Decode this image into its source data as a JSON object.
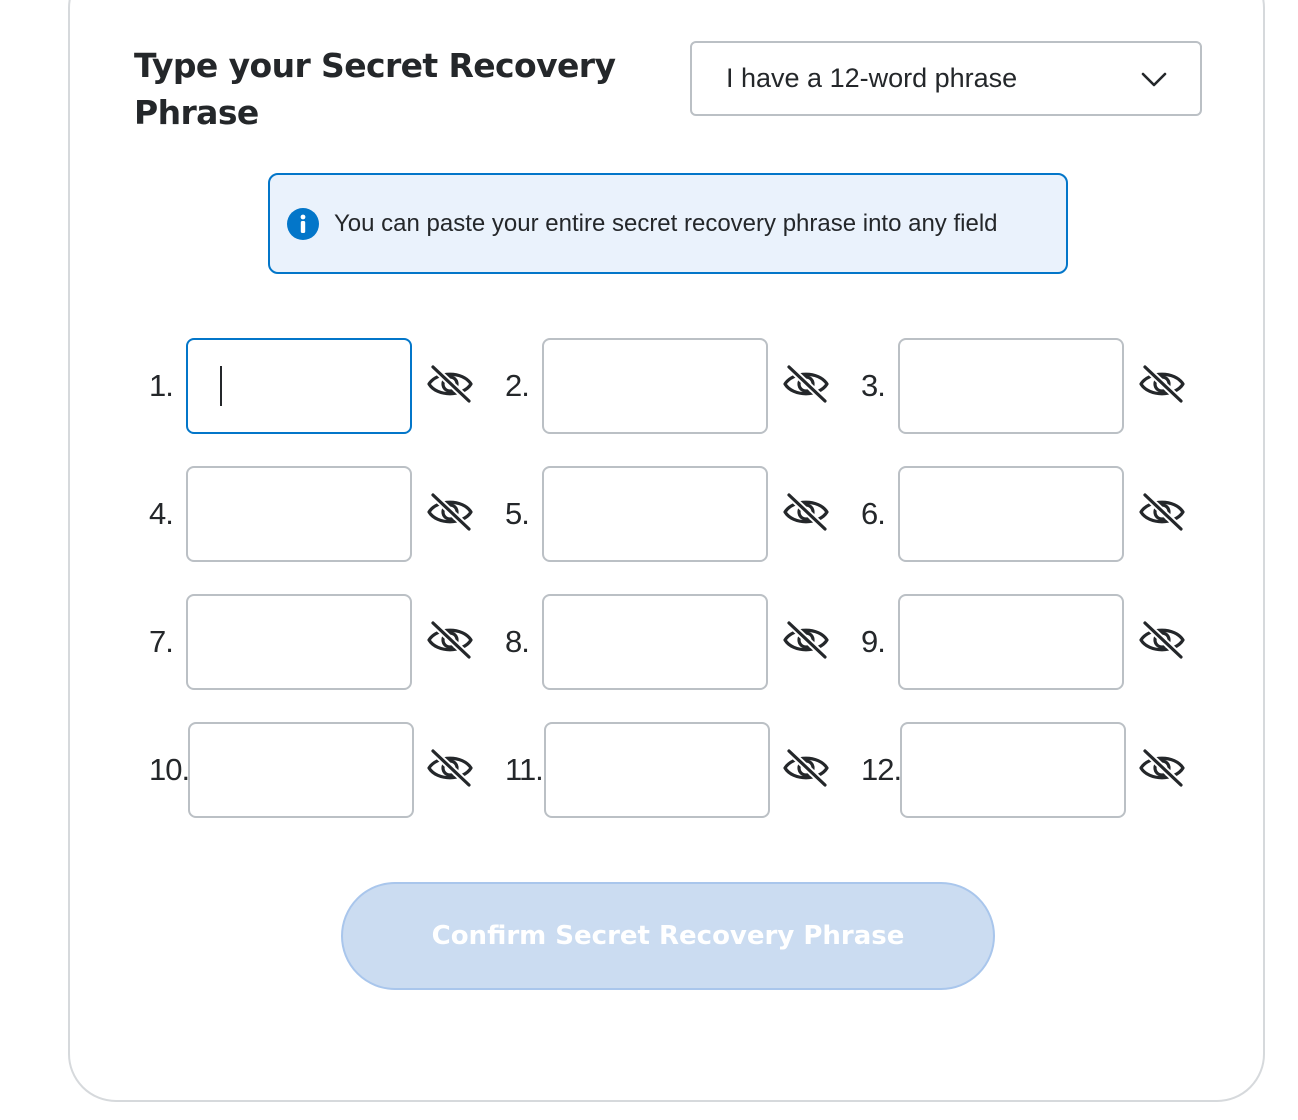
{
  "header": {
    "title": "Type your Secret Recovery Phrase"
  },
  "phrase_length_select": {
    "selected": "I have a 12-word phrase",
    "icon": "chevron-down-icon"
  },
  "info_banner": {
    "icon": "info-icon",
    "message": "You can paste your entire secret recovery phrase into any field",
    "accent_color": "#0376c9",
    "background_color": "#eaf2fc"
  },
  "words": [
    {
      "label": "1.",
      "value": "",
      "focused": true
    },
    {
      "label": "2.",
      "value": "",
      "focused": false
    },
    {
      "label": "3.",
      "value": "",
      "focused": false
    },
    {
      "label": "4.",
      "value": "",
      "focused": false
    },
    {
      "label": "5.",
      "value": "",
      "focused": false
    },
    {
      "label": "6.",
      "value": "",
      "focused": false
    },
    {
      "label": "7.",
      "value": "",
      "focused": false
    },
    {
      "label": "8.",
      "value": "",
      "focused": false
    },
    {
      "label": "9.",
      "value": "",
      "focused": false
    },
    {
      "label": "10.",
      "value": "",
      "focused": false
    },
    {
      "label": "11.",
      "value": "",
      "focused": false
    },
    {
      "label": "12.",
      "value": "",
      "focused": false
    }
  ],
  "visibility_toggle_icon": "eye-slash-icon",
  "confirm_button": {
    "label": "Confirm Secret Recovery Phrase",
    "disabled": true,
    "color": "#cbdcf1"
  }
}
